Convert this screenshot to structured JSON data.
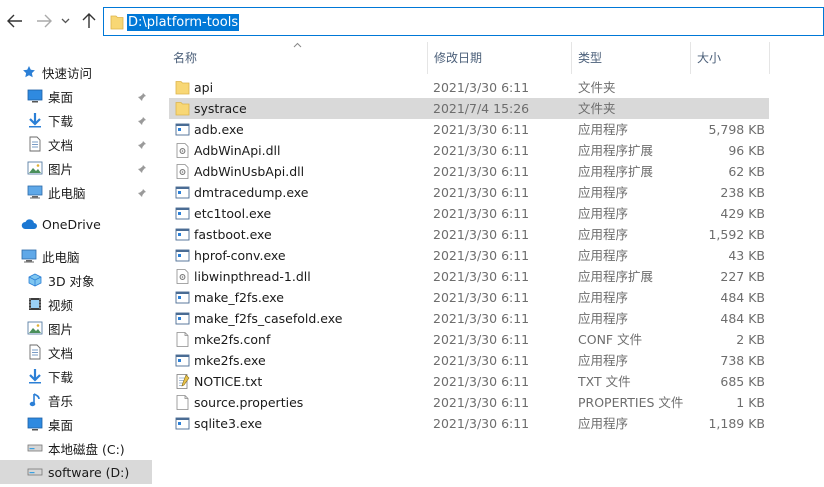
{
  "address": {
    "path": "D:\\platform-tools"
  },
  "columns": {
    "name": "名称",
    "date": "修改日期",
    "type": "类型",
    "size": "大小"
  },
  "sidebar": {
    "items": [
      {
        "label": "快速访问",
        "icon": "star-icon"
      },
      {
        "label": "桌面",
        "icon": "desktop-icon",
        "pinned": true
      },
      {
        "label": "下载",
        "icon": "download-icon",
        "pinned": true
      },
      {
        "label": "文档",
        "icon": "document-icon",
        "pinned": true
      },
      {
        "label": "图片",
        "icon": "picture-icon",
        "pinned": true
      },
      {
        "label": "此电脑",
        "icon": "computer-icon",
        "pinned": true
      },
      {
        "label": "OneDrive",
        "icon": "cloud-icon"
      },
      {
        "label": "此电脑",
        "icon": "computer-icon"
      },
      {
        "label": "3D 对象",
        "icon": "cube-icon"
      },
      {
        "label": "视频",
        "icon": "video-icon"
      },
      {
        "label": "图片",
        "icon": "picture-icon"
      },
      {
        "label": "文档",
        "icon": "document-icon"
      },
      {
        "label": "下载",
        "icon": "download-icon"
      },
      {
        "label": "音乐",
        "icon": "music-icon"
      },
      {
        "label": "桌面",
        "icon": "desktop-icon"
      },
      {
        "label": "本地磁盘 (C:)",
        "icon": "drive-icon"
      },
      {
        "label": "software (D:)",
        "icon": "drive-icon",
        "selected": true
      }
    ]
  },
  "files": [
    {
      "name": "api",
      "date": "2021/3/30 6:11",
      "type": "文件夹",
      "size": "",
      "icon": "folder-icon"
    },
    {
      "name": "systrace",
      "date": "2021/7/4 15:26",
      "type": "文件夹",
      "size": "",
      "icon": "folder-icon",
      "selected": true
    },
    {
      "name": "adb.exe",
      "date": "2021/3/30 6:11",
      "type": "应用程序",
      "size": "5,798 KB",
      "icon": "exe-icon"
    },
    {
      "name": "AdbWinApi.dll",
      "date": "2021/3/30 6:11",
      "type": "应用程序扩展",
      "size": "96 KB",
      "icon": "dll-icon"
    },
    {
      "name": "AdbWinUsbApi.dll",
      "date": "2021/3/30 6:11",
      "type": "应用程序扩展",
      "size": "62 KB",
      "icon": "dll-icon"
    },
    {
      "name": "dmtracedump.exe",
      "date": "2021/3/30 6:11",
      "type": "应用程序",
      "size": "238 KB",
      "icon": "exe-icon"
    },
    {
      "name": "etc1tool.exe",
      "date": "2021/3/30 6:11",
      "type": "应用程序",
      "size": "429 KB",
      "icon": "exe-icon"
    },
    {
      "name": "fastboot.exe",
      "date": "2021/3/30 6:11",
      "type": "应用程序",
      "size": "1,592 KB",
      "icon": "exe-icon"
    },
    {
      "name": "hprof-conv.exe",
      "date": "2021/3/30 6:11",
      "type": "应用程序",
      "size": "43 KB",
      "icon": "exe-icon"
    },
    {
      "name": "libwinpthread-1.dll",
      "date": "2021/3/30 6:11",
      "type": "应用程序扩展",
      "size": "227 KB",
      "icon": "dll-icon"
    },
    {
      "name": "make_f2fs.exe",
      "date": "2021/3/30 6:11",
      "type": "应用程序",
      "size": "484 KB",
      "icon": "exe-icon"
    },
    {
      "name": "make_f2fs_casefold.exe",
      "date": "2021/3/30 6:11",
      "type": "应用程序",
      "size": "484 KB",
      "icon": "exe-icon"
    },
    {
      "name": "mke2fs.conf",
      "date": "2021/3/30 6:11",
      "type": "CONF 文件",
      "size": "2 KB",
      "icon": "file-icon"
    },
    {
      "name": "mke2fs.exe",
      "date": "2021/3/30 6:11",
      "type": "应用程序",
      "size": "738 KB",
      "icon": "exe-icon"
    },
    {
      "name": "NOTICE.txt",
      "date": "2021/3/30 6:11",
      "type": "TXT 文件",
      "size": "685 KB",
      "icon": "text-file-icon"
    },
    {
      "name": "source.properties",
      "date": "2021/3/30 6:11",
      "type": "PROPERTIES 文件",
      "size": "1 KB",
      "icon": "file-icon"
    },
    {
      "name": "sqlite3.exe",
      "date": "2021/3/30 6:11",
      "type": "应用程序",
      "size": "1,189 KB",
      "icon": "exe-icon"
    }
  ],
  "colors": {
    "accent": "#0078d7",
    "selection": "#d9d9d9",
    "folder": "#f8d775",
    "header_text": "#4c607a"
  }
}
